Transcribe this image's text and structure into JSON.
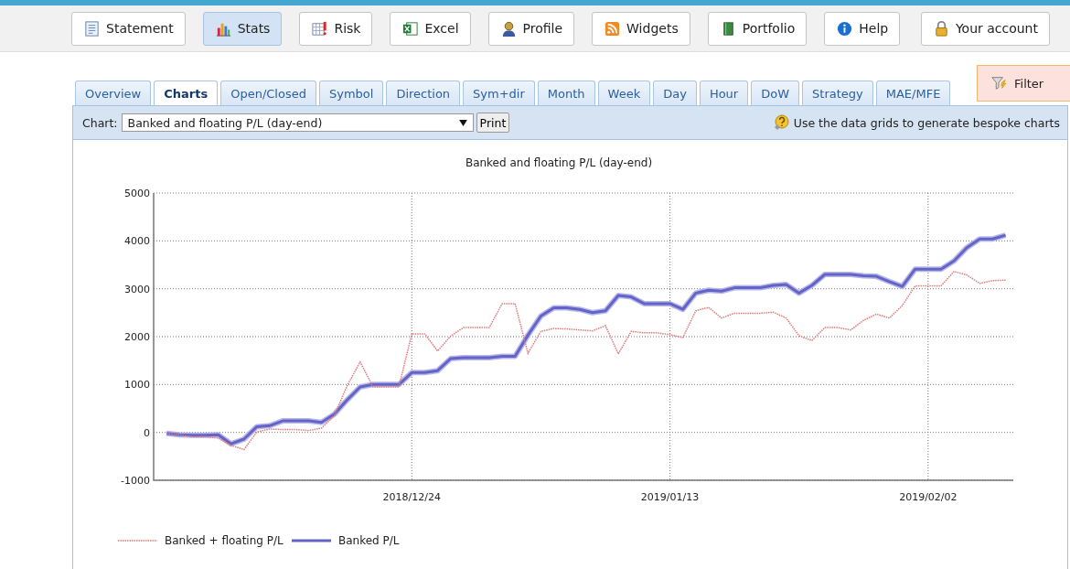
{
  "toolbar": [
    {
      "label": "Statement",
      "selected": false
    },
    {
      "label": "Stats",
      "selected": true
    },
    {
      "label": "Risk",
      "selected": false
    },
    {
      "label": "Excel",
      "selected": false
    },
    {
      "label": "Profile",
      "selected": false
    },
    {
      "label": "Widgets",
      "selected": false
    },
    {
      "label": "Portfolio",
      "selected": false
    },
    {
      "label": "Help",
      "selected": false
    },
    {
      "label": "Your account",
      "selected": false
    }
  ],
  "tabs": [
    {
      "label": "Overview",
      "selected": false
    },
    {
      "label": "Charts",
      "selected": true
    },
    {
      "label": "Open/Closed",
      "selected": false
    },
    {
      "label": "Symbol",
      "selected": false
    },
    {
      "label": "Direction",
      "selected": false
    },
    {
      "label": "Sym+dir",
      "selected": false
    },
    {
      "label": "Month",
      "selected": false
    },
    {
      "label": "Week",
      "selected": false
    },
    {
      "label": "Day",
      "selected": false
    },
    {
      "label": "Hour",
      "selected": false
    },
    {
      "label": "DoW",
      "selected": false
    },
    {
      "label": "Strategy",
      "selected": false
    },
    {
      "label": "MAE/MFE",
      "selected": false
    }
  ],
  "filter_button": "Filter",
  "chart_bar": {
    "label": "Chart:",
    "select_value": "Banked and floating P/L (day-end)",
    "print_button": "Print",
    "hint": "Use the data grids to generate bespoke charts"
  },
  "chart": {
    "chart_data": {
      "type": "line",
      "title": "Banked and floating P/L (day-end)",
      "categories": [
        null,
        null,
        null,
        null,
        null,
        null,
        null,
        null,
        null,
        null,
        null,
        null,
        null,
        null,
        null,
        null,
        null,
        null,
        null,
        "2018/12/24",
        null,
        null,
        null,
        null,
        null,
        null,
        null,
        null,
        null,
        null,
        null,
        null,
        null,
        null,
        null,
        null,
        null,
        null,
        null,
        "2019/01/13",
        null,
        null,
        null,
        null,
        null,
        null,
        null,
        null,
        null,
        null,
        null,
        null,
        null,
        null,
        null,
        null,
        null,
        null,
        null,
        "2019/02/02",
        null,
        null,
        null,
        null,
        null,
        null
      ],
      "series": [
        {
          "name": "Banked + floating P/L",
          "color": "#e07878",
          "line_style": "dashed",
          "values": [
            -20,
            -50,
            -90,
            -90,
            -120,
            -270,
            -360,
            10,
            70,
            60,
            60,
            40,
            90,
            350,
            980,
            1470,
            950,
            950,
            950,
            2060,
            2060,
            1700,
            2010,
            2190,
            2190,
            2190,
            2690,
            2690,
            1650,
            2110,
            2170,
            2160,
            2140,
            2120,
            2230,
            1640,
            2110,
            2080,
            2080,
            2040,
            1980,
            2540,
            2610,
            2390,
            2490,
            2490,
            2490,
            2510,
            2390,
            2020,
            1920,
            2190,
            2190,
            2140,
            2340,
            2470,
            2390,
            2650,
            3060,
            3060,
            3060,
            3360,
            3290,
            3110,
            3170,
            3180
          ]
        },
        {
          "name": "Banked P/L",
          "color": "#6464c8",
          "line_style": "solid",
          "values": [
            -20,
            -50,
            -60,
            -60,
            -50,
            -240,
            -140,
            120,
            140,
            240,
            240,
            240,
            210,
            380,
            680,
            950,
            1000,
            1000,
            1000,
            1250,
            1250,
            1290,
            1540,
            1560,
            1560,
            1560,
            1590,
            1590,
            2030,
            2430,
            2600,
            2600,
            2570,
            2500,
            2540,
            2860,
            2830,
            2690,
            2690,
            2690,
            2570,
            2910,
            2970,
            2950,
            3020,
            3020,
            3020,
            3070,
            3090,
            2910,
            3070,
            3300,
            3300,
            3300,
            3270,
            3260,
            3150,
            3050,
            3410,
            3410,
            3410,
            3580,
            3860,
            4040,
            4040,
            4120
          ]
        }
      ],
      "ylim": [
        -1000,
        5000
      ],
      "grid": true,
      "legend": true,
      "yticks": [
        -1000,
        0,
        1000,
        2000,
        3000,
        4000,
        5000
      ]
    }
  }
}
